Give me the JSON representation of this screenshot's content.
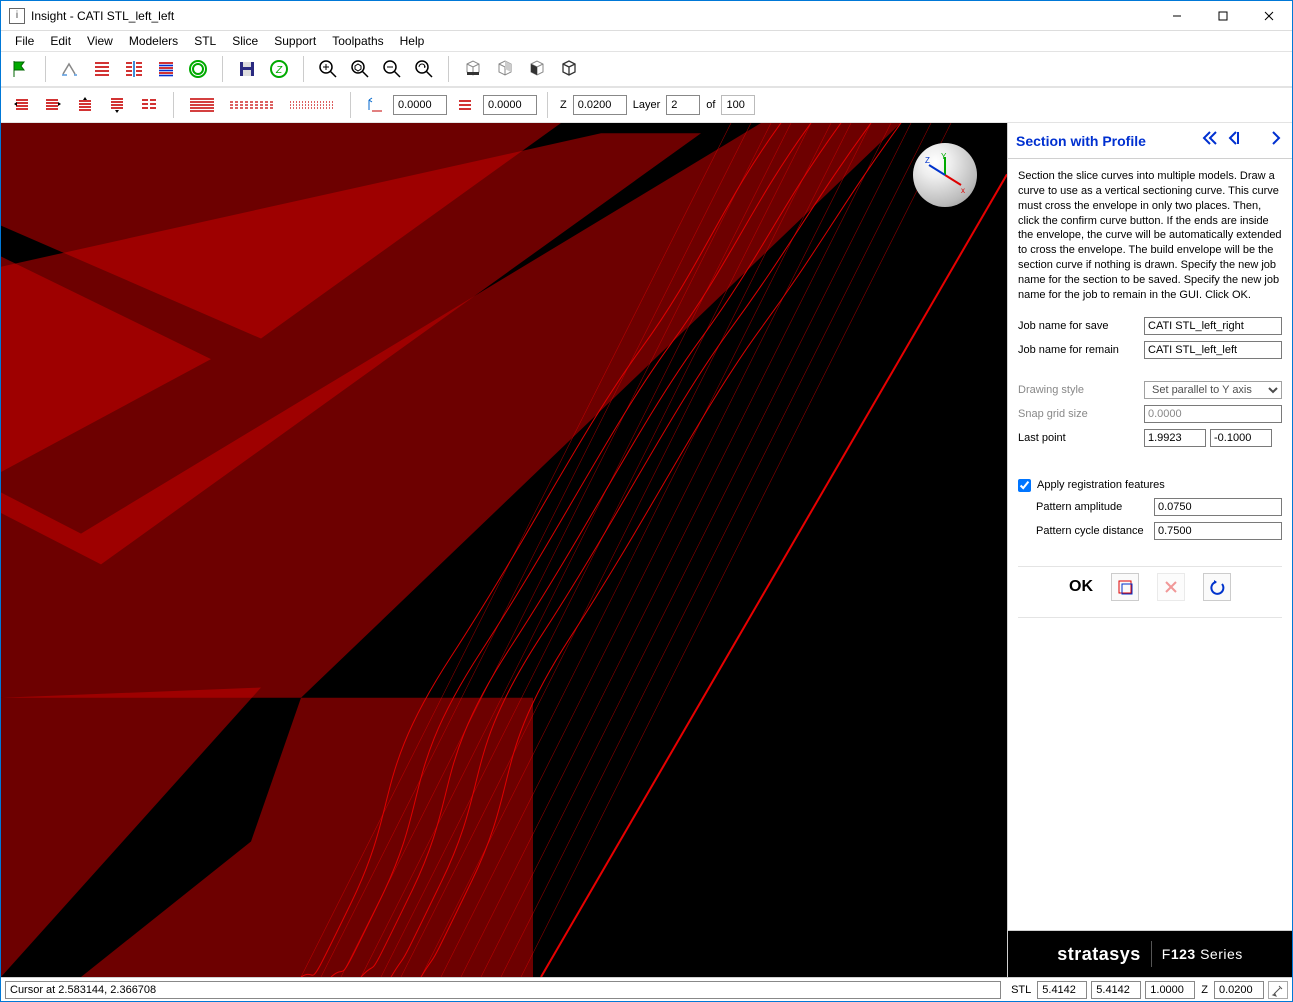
{
  "window": {
    "title": "Insight - CATI STL_left_left"
  },
  "menu": [
    "File",
    "Edit",
    "View",
    "Modelers",
    "STL",
    "Slice",
    "Support",
    "Toolpaths",
    "Help"
  ],
  "toolbar2": {
    "dim1": "0.0000",
    "dim2": "0.0000",
    "z_label": "Z",
    "z": "0.0200",
    "layer_label": "Layer",
    "layer": "2",
    "of_label": "of",
    "total": "100"
  },
  "panel": {
    "title": "Section with Profile",
    "desc": "Section the slice curves into multiple models. Draw a curve to use as a vertical sectioning curve. This curve must cross the envelope in only two places. Then, click the confirm curve button. If the ends are inside the envelope, the curve will be automatically extended to cross the envelope. The build envelope will be the section curve if nothing is drawn. Specify the new job name for the section to be saved. Specify the new job name for the job to remain in the GUI. Click OK.",
    "job_save_label": "Job name for save",
    "job_save": "CATI STL_left_right",
    "job_remain_label": "Job name for remain",
    "job_remain": "CATI STL_left_left",
    "drawing_style_label": "Drawing style",
    "drawing_style": "Set parallel to Y axis",
    "snap_label": "Snap grid size",
    "snap": "0.0000",
    "lastpt_label": "Last point",
    "lastpt_x": "1.9923",
    "lastpt_y": "-0.1000",
    "apply_reg_label": "Apply registration features",
    "amp_label": "Pattern amplitude",
    "amp": "0.0750",
    "cycle_label": "Pattern cycle distance",
    "cycle": "0.7500",
    "ok": "OK"
  },
  "brand": {
    "a": "stratasys",
    "b1": "F",
    "b2": "123",
    "b3": " Series"
  },
  "status": {
    "cursor": "Cursor at 2.583144, 2.366708",
    "stl_label": "STL",
    "x": "5.4142",
    "y": "5.4142",
    "h": "1.0000",
    "z_label": "Z",
    "z": "0.0200"
  }
}
